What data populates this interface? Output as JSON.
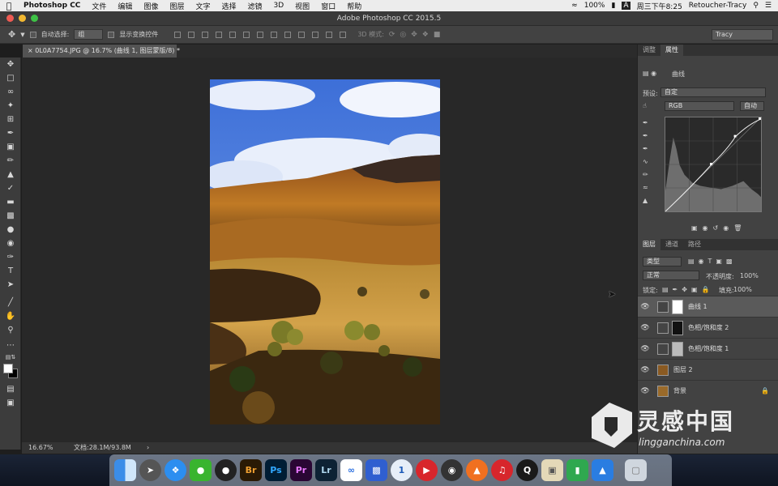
{
  "menubar": {
    "app_name": "Photoshop CC",
    "items": [
      "文件",
      "编辑",
      "图像",
      "图层",
      "文字",
      "选择",
      "滤镜",
      "3D",
      "视图",
      "窗口",
      "帮助"
    ],
    "battery": "100%",
    "clock": "周三下午8:25",
    "user": "Retoucher-Tracy"
  },
  "window": {
    "title": "Adobe Photoshop CC 2015.5"
  },
  "options_bar": {
    "auto_select_label": "自动选择:",
    "auto_select_value": "组",
    "transform_label": "显示变换控件",
    "mode_3d_label": "3D 模式:",
    "workspace": "Tracy"
  },
  "document_tab": {
    "label": "0L0A7754.JPG @ 16.7% (曲线 1, 图层蒙版/8) *"
  },
  "status_bar": {
    "zoom": "16.67%",
    "doc_size": "文档:28.1M/93.8M"
  },
  "properties_panel": {
    "tabs": [
      "调整",
      "属性"
    ],
    "active_tab": "属性",
    "adjustment_name": "曲线",
    "preset_label": "预设:",
    "preset_value": "自定",
    "channel_value": "RGB",
    "auto_button": "自动"
  },
  "layers_panel": {
    "tabs": [
      "图层",
      "通道",
      "路径"
    ],
    "active_tab": "图层",
    "filter_kind": "类型",
    "blend_mode": "正常",
    "opacity_label": "不透明度:",
    "opacity_value": "100%",
    "lock_label": "锁定:",
    "fill_label": "填充:",
    "fill_value": "100%",
    "layers": [
      {
        "name": "曲线 1",
        "selected": true
      },
      {
        "name": "色相/饱和度 2",
        "selected": false
      },
      {
        "name": "色相/饱和度 1",
        "selected": false
      },
      {
        "name": "图层 2",
        "selected": false
      },
      {
        "name": "背景",
        "selected": false
      }
    ]
  },
  "watermark": {
    "title": "灵感中国",
    "url": "lingganchina.com"
  },
  "dock": {
    "apps": [
      "finder-icon",
      "launchpad-icon",
      "safari-icon",
      "wechat-icon",
      "qq-icon",
      "bridge-icon",
      "photoshop-icon",
      "premiere-icon",
      "lightroom-icon",
      "baidu-netdisk-icon",
      "video-editor-icon",
      "onepassword-icon",
      "player-icon",
      "obs-icon",
      "app-icon",
      "netease-music-icon",
      "quicktime-icon",
      "preview-icon",
      "numbers-icon",
      "keynote-icon",
      "trash-icon"
    ],
    "labels": {
      "bridge": "Br",
      "photoshop": "Ps",
      "premiere": "Pr",
      "lightroom": "Lr"
    }
  },
  "colors": {
    "ps_blue": "#31a8ff",
    "br_orange": "#f0a030",
    "pr_purple": "#ea77ff",
    "lr_blue": "#add5ec"
  }
}
